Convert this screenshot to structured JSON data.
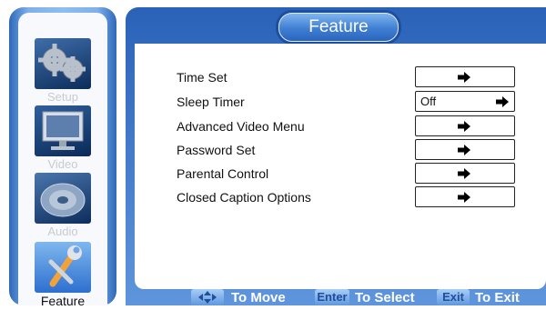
{
  "sidebar": {
    "items": [
      {
        "label": "Setup",
        "icon": "gear-icon"
      },
      {
        "label": "Video",
        "icon": "monitor-icon"
      },
      {
        "label": "Audio",
        "icon": "speaker-icon"
      },
      {
        "label": "Feature",
        "icon": "wrench-icon",
        "active": true
      }
    ]
  },
  "header": {
    "title": "Feature"
  },
  "options": [
    {
      "label": "Time Set",
      "value": ""
    },
    {
      "label": "Sleep Timer",
      "value": "Off"
    },
    {
      "label": "Advanced Video Menu",
      "value": ""
    },
    {
      "label": "Password Set",
      "value": ""
    },
    {
      "label": "Parental Control",
      "value": ""
    },
    {
      "label": "Closed Caption Options",
      "value": ""
    }
  ],
  "footer": {
    "move_key": "",
    "move_label": "To Move",
    "select_key": "Enter",
    "select_label": "To Select",
    "exit_key": "Exit",
    "exit_label": "To Exit"
  },
  "colors": {
    "frame_blue": "#2a62b8",
    "accent_light_blue": "#7fb4ef",
    "inactive_label": "#c8cbd2"
  }
}
